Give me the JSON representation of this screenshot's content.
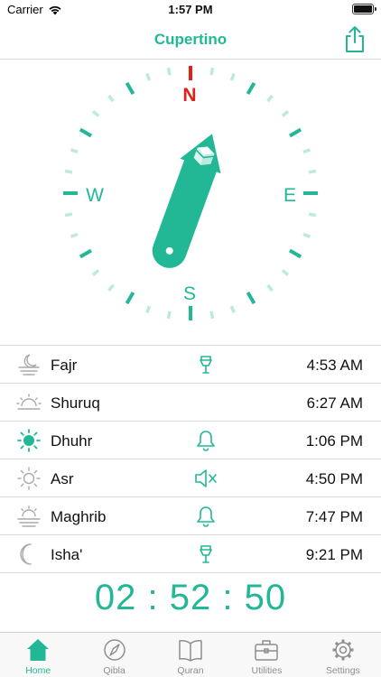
{
  "status_bar": {
    "carrier": "Carrier",
    "time": "1:57 PM"
  },
  "header": {
    "title": "Cupertino",
    "share_icon": "share-icon"
  },
  "compass": {
    "north": "N",
    "east": "E",
    "south": "S",
    "west": "W",
    "accent": "#22b896",
    "north_color": "#e0201a",
    "qibla_bearing_deg": 20
  },
  "prayers": [
    {
      "name": "Fajr",
      "time": "4:53 AM",
      "icon": "fajr-icon",
      "alert": "speaker-icon"
    },
    {
      "name": "Shuruq",
      "time": "6:27 AM",
      "icon": "sunrise-icon",
      "alert": ""
    },
    {
      "name": "Dhuhr",
      "time": "1:06 PM",
      "icon": "sun-icon",
      "alert": "bell-icon"
    },
    {
      "name": "Asr",
      "time": "4:50 PM",
      "icon": "sun-outline-icon",
      "alert": "mute-icon"
    },
    {
      "name": "Maghrib",
      "time": "7:47 PM",
      "icon": "sunset-icon",
      "alert": "bell-icon"
    },
    {
      "name": "Isha'",
      "time": "9:21 PM",
      "icon": "moon-icon",
      "alert": "speaker-icon"
    }
  ],
  "countdown": {
    "hours": "02",
    "sep1": ":",
    "minutes": "52",
    "sep2": ":",
    "seconds": "50"
  },
  "tabs": [
    {
      "label": "Home",
      "icon": "home-icon",
      "active": true
    },
    {
      "label": "Qibla",
      "icon": "compass-icon",
      "active": false
    },
    {
      "label": "Quran",
      "icon": "book-icon",
      "active": false
    },
    {
      "label": "Utilities",
      "icon": "toolbox-icon",
      "active": false
    },
    {
      "label": "Settings",
      "icon": "gear-icon",
      "active": false
    }
  ]
}
